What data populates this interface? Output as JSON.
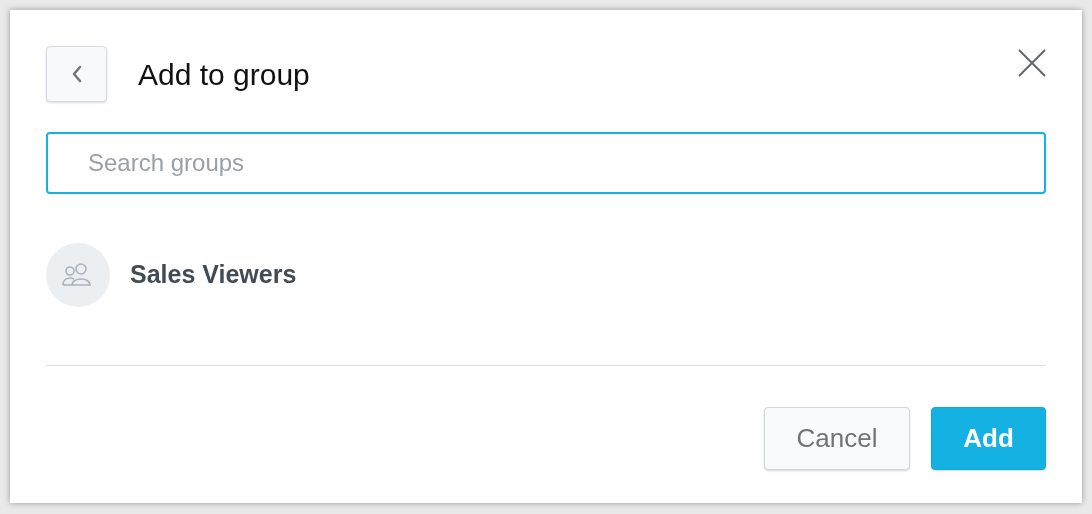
{
  "dialog": {
    "title": "Add to group"
  },
  "search": {
    "placeholder": "Search groups"
  },
  "groups": [
    {
      "name": "Sales Viewers"
    }
  ],
  "buttons": [
    {
      "label": "Cancel",
      "kind": "secondary"
    },
    {
      "label": "Add",
      "kind": "primary"
    }
  ]
}
